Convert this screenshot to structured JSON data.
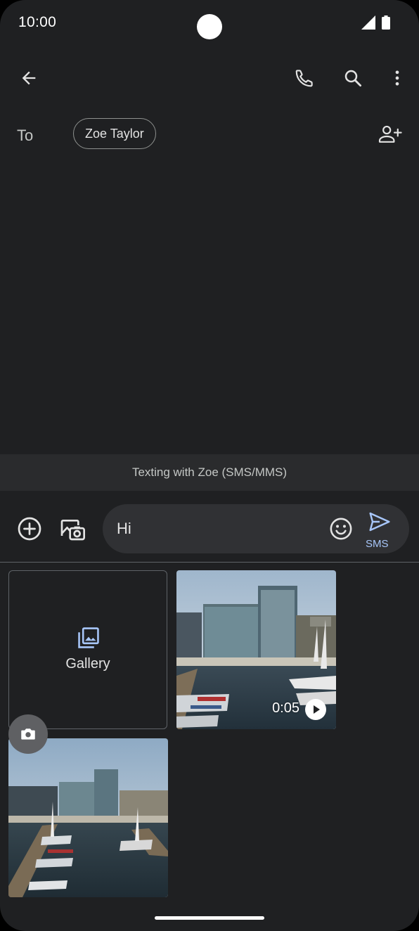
{
  "status_bar": {
    "time": "10:00",
    "icons": [
      "signal-icon",
      "battery-icon"
    ]
  },
  "app_bar": {
    "icons": [
      "back-arrow-icon",
      "phone-icon",
      "search-icon",
      "more-vert-icon"
    ]
  },
  "recipient": {
    "to_label": "To",
    "chip": "Zoe Taylor",
    "add_icon": "add-person-icon"
  },
  "banner": {
    "text": "Texting with Zoe (SMS/MMS)"
  },
  "compose": {
    "message_value": "Hi",
    "send_label": "SMS",
    "icons": [
      "add-circle-icon",
      "add-media-camera-icon",
      "emoji-icon",
      "send-icon"
    ]
  },
  "media_picker": {
    "gallery_label": "Gallery",
    "video_duration": "0:05",
    "icons": [
      "gallery-icon",
      "play-icon",
      "camera-icon"
    ]
  },
  "colors": {
    "background": "#1f2022",
    "accent": "#a8c7fa",
    "text": "#e3e3e3"
  }
}
